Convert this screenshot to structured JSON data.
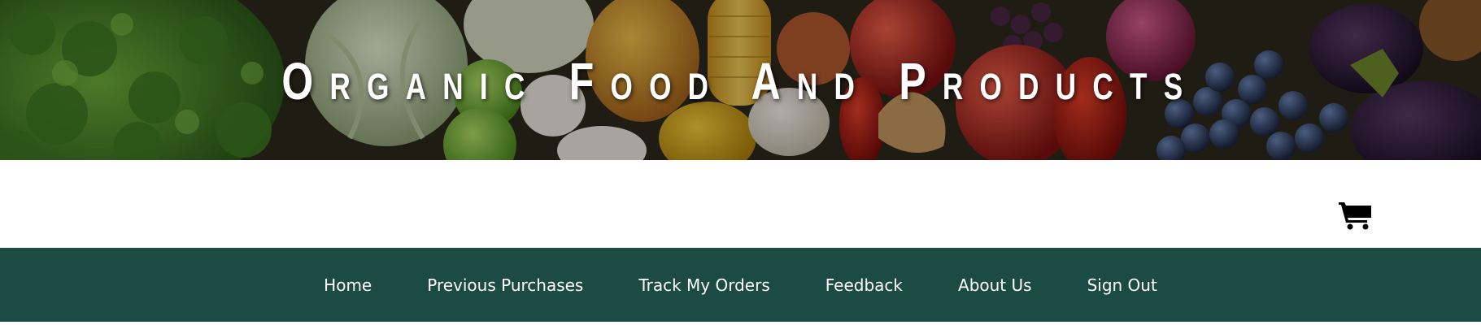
{
  "banner": {
    "title": "Organic Food And Products"
  },
  "cart": {
    "icon": "shopping-cart-icon"
  },
  "nav": {
    "items": [
      {
        "label": "Home"
      },
      {
        "label": "Previous Purchases"
      },
      {
        "label": "Track My Orders"
      },
      {
        "label": "Feedback"
      },
      {
        "label": "About Us"
      },
      {
        "label": "Sign Out"
      }
    ]
  },
  "colors": {
    "nav_background": "#1c4a45",
    "nav_text": "#ffffff",
    "page_background": "#ffffff",
    "title_text": "#ffffff"
  }
}
